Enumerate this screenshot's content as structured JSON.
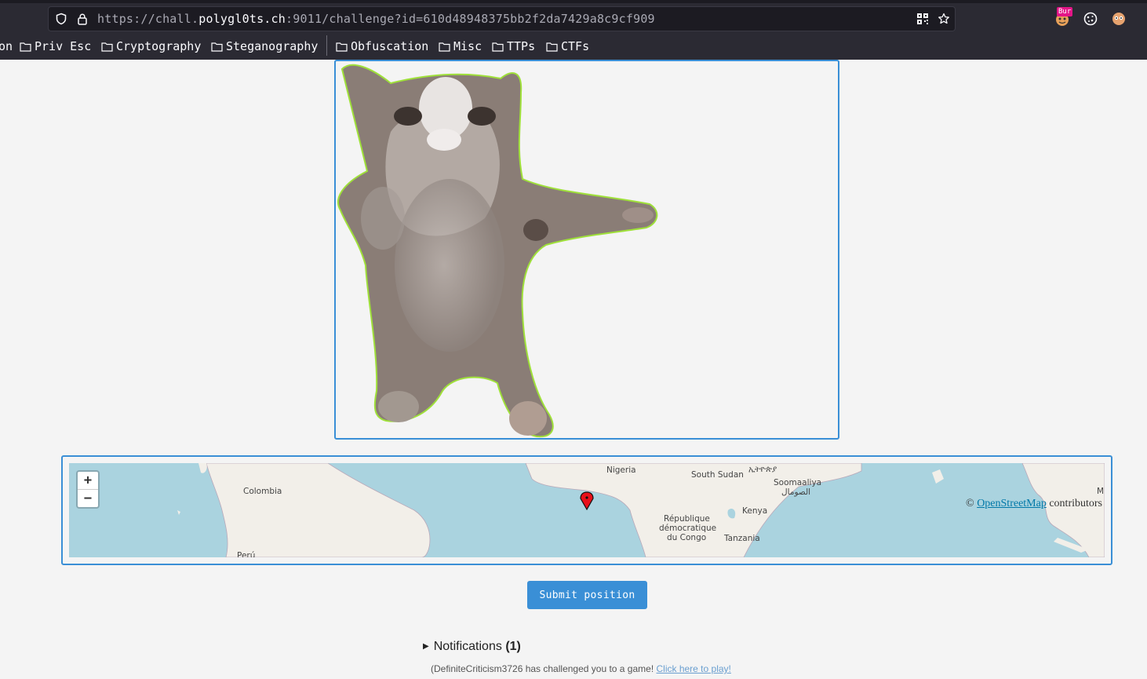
{
  "browser": {
    "url_prefix": "https://chall.",
    "url_host": "polygl0ts.ch",
    "url_rest": ":9011/challenge?id=610d48948375bb2f2da7429a8c9cf909",
    "extension_badge": "Bur",
    "bookmarks": [
      {
        "label": "on",
        "folder": false
      },
      {
        "label": "Priv Esc",
        "folder": true
      },
      {
        "label": "Cryptography",
        "folder": true
      },
      {
        "label": "Steganography",
        "folder": true
      },
      {
        "label": "Obfuscation",
        "folder": true
      },
      {
        "label": "Misc",
        "folder": true
      },
      {
        "label": "TTPs",
        "folder": true
      },
      {
        "label": "CTFs",
        "folder": true
      }
    ]
  },
  "map": {
    "zoom_in": "+",
    "zoom_out": "−",
    "attribution_prefix": "©",
    "attribution_link": "OpenStreetMap",
    "attribution_suffix": "contributors",
    "labels": {
      "colombia": "Colombia",
      "peru": "Perú",
      "nigeria": "Nigeria",
      "south_sudan": "South Sudan",
      "ethiopia": "ኢትዮጵያ",
      "somalia": "Soomaaliya",
      "somalia_ar": "الصومال",
      "kenya": "Kenya",
      "drc_1": "République",
      "drc_2": "démocratique",
      "drc_3": "du Congo",
      "tanzania": "Tanzania",
      "edge": "M"
    },
    "marker_icon": "map-pin-icon"
  },
  "submit_label": "Submit position",
  "notifications": {
    "label": "Notifications",
    "count": "(1)",
    "message": "(DefiniteCriticism3726 has challenged you to a game!",
    "link": "Click here to play!"
  }
}
